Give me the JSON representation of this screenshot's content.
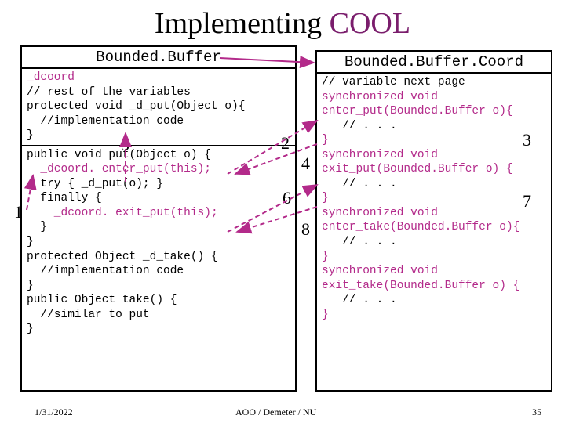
{
  "title": {
    "black": "Implementing ",
    "purple": "COOL"
  },
  "left": {
    "header": "Bounded.Buffer",
    "top_lines": [
      {
        "t": "_dcoord",
        "cool": true
      },
      {
        "t": "// rest of the variables",
        "cool": false
      },
      {
        "t": "protected void _d_put(Object o){",
        "cool": false
      },
      {
        "t": "  //implementation code",
        "cool": false
      },
      {
        "t": "}",
        "cool": false
      }
    ],
    "bottom_lines": [
      {
        "t": "public void put(Object o) {",
        "cool": false
      },
      {
        "t": "  _dcoord. enter_put(this);",
        "cool": true
      },
      {
        "t": "  try { _d_put(o); }",
        "cool": false
      },
      {
        "t": "  finally {",
        "cool": false
      },
      {
        "t": "    _dcoord. exit_put(this);",
        "cool": true
      },
      {
        "t": "  }",
        "cool": false
      },
      {
        "t": "}",
        "cool": false
      },
      {
        "t": "protected Object _d_take() {",
        "cool": false
      },
      {
        "t": "  //implementation code",
        "cool": false
      },
      {
        "t": "}",
        "cool": false
      },
      {
        "t": "public Object take() {",
        "cool": false
      },
      {
        "t": "  //similar to put",
        "cool": false
      },
      {
        "t": "}",
        "cool": false
      }
    ]
  },
  "right": {
    "header": "Bounded.Buffer.Coord",
    "lines": [
      {
        "t": "// variable next page",
        "cool": false
      },
      {
        "t": "synchronized void",
        "cool": true
      },
      {
        "t": "enter_put(Bounded.Buffer o){",
        "cool": true
      },
      {
        "t": "   // . . .",
        "cool": false
      },
      {
        "t": "}",
        "cool": true
      },
      {
        "t": "synchronized void",
        "cool": true
      },
      {
        "t": "exit_put(Bounded.Buffer o) {",
        "cool": true
      },
      {
        "t": "   // . . .",
        "cool": false
      },
      {
        "t": "}",
        "cool": true
      },
      {
        "t": "synchronized void",
        "cool": true
      },
      {
        "t": "enter_take(Bounded.Buffer o){",
        "cool": true
      },
      {
        "t": "   // . . .",
        "cool": false
      },
      {
        "t": "}",
        "cool": true
      },
      {
        "t": "synchronized void",
        "cool": true
      },
      {
        "t": "exit_take(Bounded.Buffer o) {",
        "cool": true
      },
      {
        "t": "   // . . .",
        "cool": false
      },
      {
        "t": "}",
        "cool": true
      }
    ]
  },
  "nums": {
    "n1": "1",
    "n2": "2",
    "n3": "3",
    "n4": "4",
    "n5": "5",
    "n6": "6",
    "n7": "7",
    "n8": "8"
  },
  "footer": {
    "left": "1/31/2022",
    "center": "AOO / Demeter / NU",
    "right": "35"
  }
}
